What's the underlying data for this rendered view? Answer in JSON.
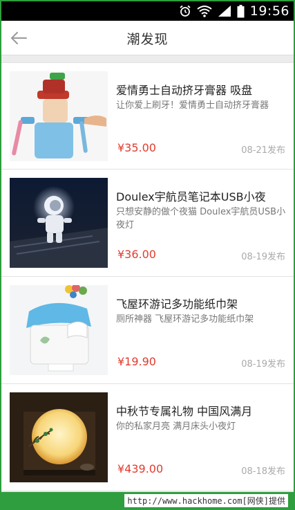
{
  "status_bar": {
    "time": "19:56",
    "icons": [
      "alarm-icon",
      "wifi-icon",
      "signal-icon",
      "battery-icon"
    ]
  },
  "header": {
    "title": "潮发现",
    "back_icon": "back-arrow-icon"
  },
  "items": [
    {
      "title": "爱情勇士自动挤牙膏器 吸盘",
      "description": "让你爱上刷牙！爱情勇士自动挤牙膏器",
      "price": "¥35.00",
      "date": "08-21发布"
    },
    {
      "title": "Doulex宇航员笔记本USB小夜",
      "description": "只想安静的做个夜猫 Doulex宇航员USB小夜灯",
      "price": "¥36.00",
      "date": "08-19发布"
    },
    {
      "title": "飞屋环游记多功能纸巾架",
      "description": "厕所神器 飞屋环游记多功能纸巾架",
      "price": "¥19.90",
      "date": "08-19发布"
    },
    {
      "title": "中秋节专属礼物 中国风满月",
      "description": "你的私家月亮 满月床头小夜灯",
      "price": "¥439.00",
      "date": "08-18发布"
    }
  ],
  "footer": {
    "credit": "http://www.hackhome.com[网侠]提供"
  },
  "colors": {
    "price": "#e23b2e",
    "footer": "#2e9e3e"
  }
}
